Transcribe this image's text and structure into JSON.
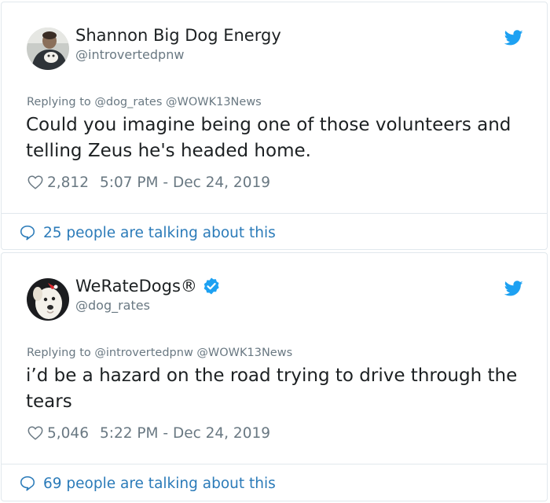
{
  "colors": {
    "text": "#1c2022",
    "muted": "#697882",
    "link": "#2b7bb9",
    "twitter_blue": "#1da1f2",
    "border": "#e1e8ed"
  },
  "tweets": [
    {
      "display_name": "Shannon Big Dog Energy",
      "handle": "@introvertedpnw",
      "verified": false,
      "avatar_icon": "user-avatar-photo",
      "reply_label": "Replying to",
      "reply_mentions": "@dog_rates @WOWK13News",
      "text": "Could you imagine being one of those volunteers and telling Zeus he's headed home.",
      "likes": "2,812",
      "timestamp": "5:07 PM - Dec 24, 2019",
      "talking": "25 people are talking about this"
    },
    {
      "display_name": "WeRateDogs®",
      "handle": "@dog_rates",
      "verified": true,
      "avatar_icon": "dog-avatar-photo",
      "reply_label": "Replying to",
      "reply_mentions": "@introvertedpnw @WOWK13News",
      "text": "i’d be a hazard on the road trying to drive through the tears",
      "likes": "5,046",
      "timestamp": "5:22 PM - Dec 24, 2019",
      "talking": "69 people are talking about this"
    }
  ]
}
